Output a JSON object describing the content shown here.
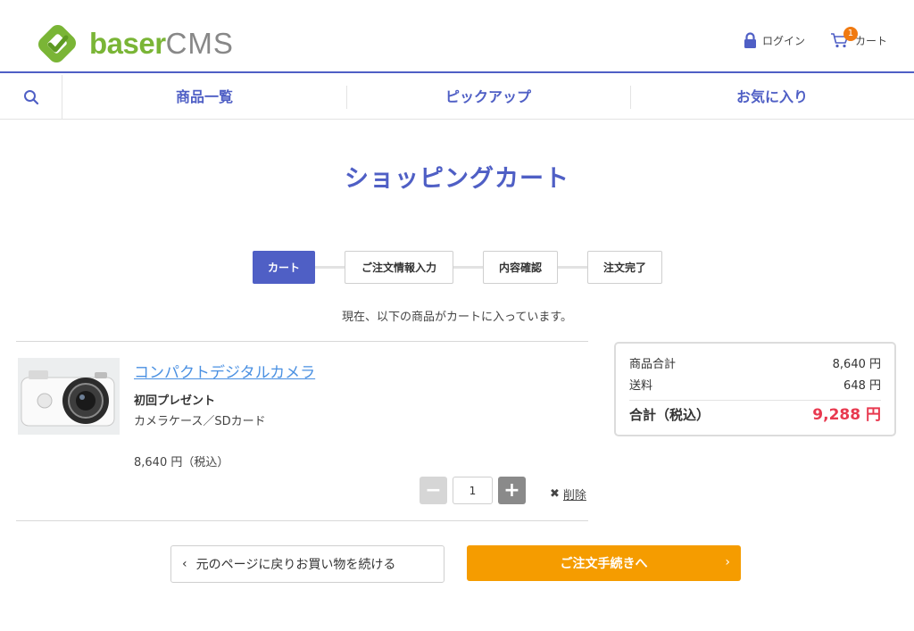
{
  "header": {
    "logo_word_a": "baser",
    "logo_word_b": "CMS",
    "login_label": "ログイン",
    "cart_label": "カート",
    "cart_count": "1"
  },
  "nav": {
    "items": [
      {
        "label": "商品一覧"
      },
      {
        "label": "ピックアップ"
      },
      {
        "label": "お気に入り"
      }
    ]
  },
  "page": {
    "title": "ショッピングカート",
    "intro": "現在、以下の商品がカートに入っています。"
  },
  "steps": [
    {
      "label": "カート",
      "active": true
    },
    {
      "label": "ご注文情報入力",
      "active": false
    },
    {
      "label": "内容確認",
      "active": false
    },
    {
      "label": "注文完了",
      "active": false
    }
  ],
  "cart": {
    "items": [
      {
        "name": "コンパクトデジタルカメラ",
        "option_title": "初回プレゼント",
        "option_value": "カメラケース／SDカード",
        "price": "8,640 円（税込）",
        "quantity": "1",
        "delete_label": "削除"
      }
    ]
  },
  "summary": {
    "subtotal_label": "商品合計",
    "subtotal_value": "8,640 円",
    "shipping_label": "送料",
    "shipping_value": "648 円",
    "total_label": "合計（税込）",
    "total_value": "9,288 円"
  },
  "actions": {
    "back_label": "元のページに戻りお買い物を続ける",
    "next_label": "ご注文手続きへ"
  },
  "colors": {
    "accent": "#4f5fc5",
    "logo_green": "#7ab536",
    "badge": "#f07a11",
    "total": "#e8394f",
    "cta": "#f59c00"
  }
}
